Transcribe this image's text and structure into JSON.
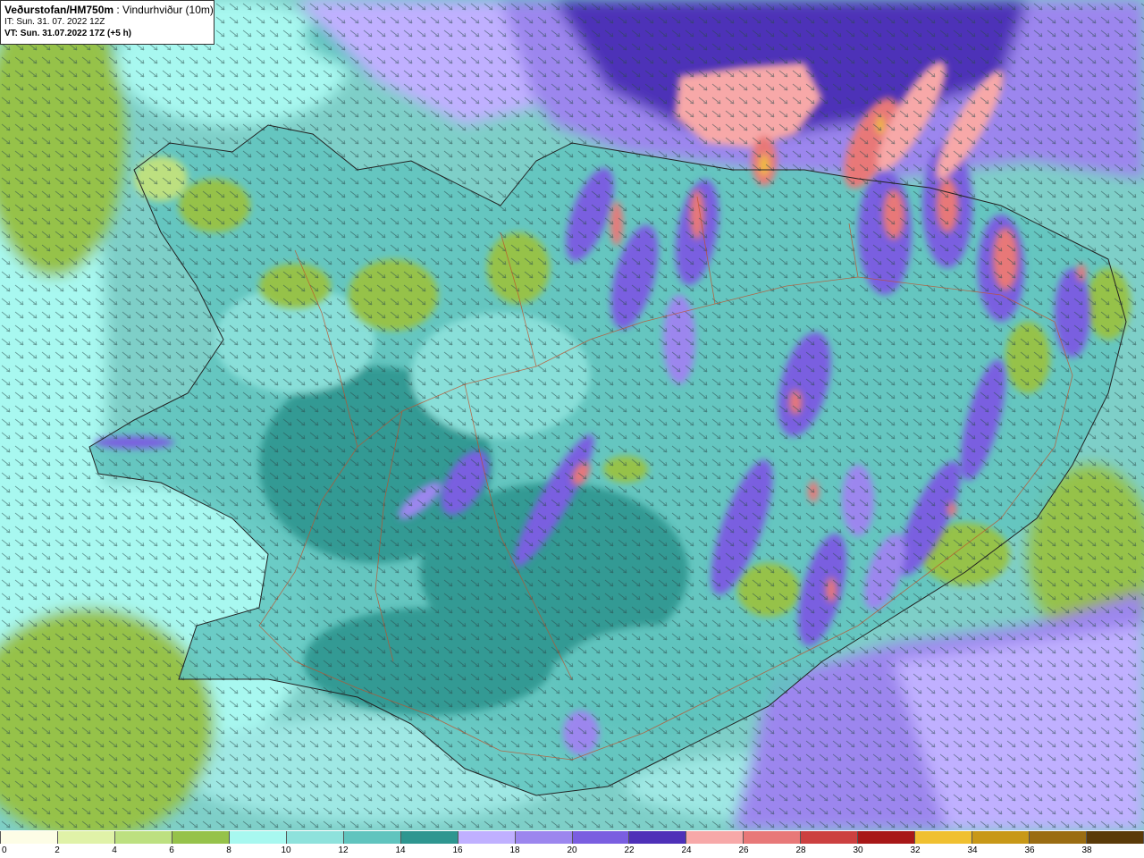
{
  "header": {
    "title": "Veðurstofan/HM750m",
    "variable": ": Vindurhviður (10m)",
    "init_time": "IT: Sun. 31. 07. 2022 12Z",
    "valid_time": "VT: Sun. 31.07.2022 17Z (+5 h)"
  },
  "legend": {
    "labels": [
      "0",
      "2",
      "4",
      "6",
      "8",
      "10",
      "12",
      "14",
      "16",
      "18",
      "20",
      "22",
      "24",
      "26",
      "28",
      "30",
      "32",
      "34",
      "36",
      "38"
    ],
    "colors": [
      "#fdfde6",
      "#e0f2a8",
      "#bde080",
      "#96c24a",
      "#a8f8f0",
      "#8ee2dc",
      "#60c4be",
      "#2e9690",
      "#c0b0ff",
      "#9c86ee",
      "#7a5ee0",
      "#4e30b8",
      "#f7a8a8",
      "#e87878",
      "#cc4040",
      "#a81818",
      "#f0c030",
      "#c89818",
      "#9a6c12",
      "#5a3a08"
    ]
  },
  "map": {
    "colors": {
      "sea": "#7ecfc8",
      "sea_light": "#9fe8e4",
      "coast_line": "#222222",
      "road_line": "#c0502a"
    }
  }
}
